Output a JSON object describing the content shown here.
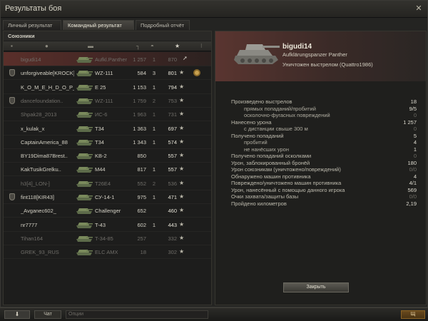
{
  "window": {
    "title": "Результаты боя",
    "close": "✕"
  },
  "tabs": [
    {
      "label": "Личный результат",
      "active": false
    },
    {
      "label": "Командный результат",
      "active": true
    },
    {
      "label": "Подробный отчёт",
      "active": false
    }
  ],
  "team": {
    "header": "Союзники",
    "rows": [
      {
        "name": "bigudi14",
        "vehicle": "Aufkl.Panther",
        "damage": "1 257",
        "kills": "1",
        "xp": "870",
        "highlight": true,
        "dead": true,
        "lic": false,
        "icon": "cursor-icon"
      },
      {
        "name": "unforgiveable[KROCK]",
        "vehicle": "WZ-111",
        "damage": "584",
        "kills": "3",
        "xp": "801",
        "highlight": false,
        "dead": false,
        "lic": true,
        "medal": true
      },
      {
        "name": "K_O_M_E_H_D_O_P_",
        "vehicle": "E 25",
        "damage": "1 153",
        "kills": "1",
        "xp": "794",
        "highlight": false,
        "dead": false,
        "lic": false
      },
      {
        "name": "dancefoundation..",
        "vehicle": "WZ-111",
        "damage": "1 759",
        "kills": "2",
        "xp": "753",
        "highlight": false,
        "dead": true,
        "lic": true
      },
      {
        "name": "Shpak28_2013",
        "vehicle": "ИС-6",
        "damage": "1 963",
        "kills": "1",
        "xp": "731",
        "highlight": false,
        "dead": true,
        "lic": false
      },
      {
        "name": "x_kulak_x",
        "vehicle": "T34",
        "damage": "1 363",
        "kills": "1",
        "xp": "697",
        "highlight": false,
        "dead": false,
        "lic": false
      },
      {
        "name": "CaptainAmerica_88",
        "vehicle": "T34",
        "damage": "1 343",
        "kills": "1",
        "xp": "574",
        "highlight": false,
        "dead": false,
        "lic": false
      },
      {
        "name": "BY19Dima87Brest..",
        "vehicle": "KB-2",
        "damage": "850",
        "kills": "",
        "xp": "557",
        "highlight": false,
        "dead": false,
        "lic": false
      },
      {
        "name": "KakTusikGrelku..",
        "vehicle": "M44",
        "damage": "817",
        "kills": "1",
        "xp": "557",
        "highlight": false,
        "dead": false,
        "lic": false
      },
      {
        "name": "h3[4]_LON-]",
        "vehicle": "T26E4",
        "damage": "552",
        "kills": "2",
        "xp": "536",
        "highlight": false,
        "dead": true,
        "lic": false
      },
      {
        "name": "fint118[KIR43]",
        "vehicle": "СУ-14-1",
        "damage": "975",
        "kills": "1",
        "xp": "471",
        "highlight": false,
        "dead": false,
        "lic": true
      },
      {
        "name": "_Avganec602_",
        "vehicle": "Challenger",
        "damage": "652",
        "kills": "",
        "xp": "460",
        "highlight": false,
        "dead": false,
        "lic": false
      },
      {
        "name": "nr7777",
        "vehicle": "T-43",
        "damage": "602",
        "kills": "1",
        "xp": "443",
        "highlight": false,
        "dead": false,
        "lic": false
      },
      {
        "name": "Tihan164",
        "vehicle": "T-34-85",
        "damage": "257",
        "kills": "",
        "xp": "332",
        "highlight": false,
        "dead": true,
        "lic": false
      },
      {
        "name": "GREK_93_RUS",
        "vehicle": "ELC AMX",
        "damage": "18",
        "kills": "",
        "xp": "302",
        "highlight": false,
        "dead": true,
        "lic": false
      }
    ]
  },
  "detail": {
    "player": "bigudi14",
    "vehicle": "Aufklärungspanzer Panther",
    "killed_by": "Уничтожен выстрелом (Quattro1986)",
    "stats": [
      {
        "label": "Произведено выстрелов",
        "value": "18",
        "sub": false,
        "zero": false
      },
      {
        "label": "прямых попаданий/пробитий",
        "value": "9/5",
        "sub": true,
        "zero": false
      },
      {
        "label": "осколочно-фугасных повреждений",
        "value": "0",
        "sub": true,
        "zero": true
      },
      {
        "label": "Нанесено урона",
        "value": "1 257",
        "sub": false,
        "zero": false
      },
      {
        "label": "с дистанции свыше 300 м",
        "value": "0",
        "sub": true,
        "zero": true
      },
      {
        "label": "Получено попаданий",
        "value": "5",
        "sub": false,
        "zero": false
      },
      {
        "label": "пробитий",
        "value": "4",
        "sub": true,
        "zero": false
      },
      {
        "label": "не нанёсших урон",
        "value": "1",
        "sub": true,
        "zero": false
      },
      {
        "label": "Получено попаданий осколками",
        "value": "0",
        "sub": false,
        "zero": true
      },
      {
        "label": "Урон, заблокированный бронёй",
        "value": "180",
        "sub": false,
        "zero": false
      },
      {
        "label": "Урон союзникам (уничтожено/повреждений)",
        "value": "0/0",
        "sub": false,
        "zero": true
      },
      {
        "label": "Обнаружено машин противника",
        "value": "4",
        "sub": false,
        "zero": false
      },
      {
        "label": "Повреждено/уничтожено машин противника",
        "value": "4/1",
        "sub": false,
        "zero": false
      },
      {
        "label": "Урон, нанесённый с помощью данного игрока",
        "value": "569",
        "sub": false,
        "zero": false
      },
      {
        "label": "Очки захвата/защиты базы",
        "value": "0/0",
        "sub": false,
        "zero": true
      },
      {
        "label": "Пройдено километров",
        "value": "2,19",
        "sub": false,
        "zero": false
      }
    ],
    "close_button": "Закрыть"
  },
  "bottom": {
    "btn1": "⬇",
    "btn2": "Чат",
    "field": "Опции",
    "btn3": "Щ"
  }
}
